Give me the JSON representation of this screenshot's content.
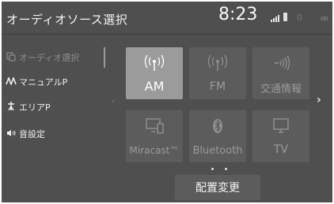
{
  "header": {
    "title": "オーディオソース選択",
    "clock": "8:23"
  },
  "sidebar": {
    "items": [
      {
        "label": "オーディオ選択",
        "icon": "audio-source-icon",
        "state": "selected"
      },
      {
        "label": "マニュアルP",
        "icon": "manual-preset-icon"
      },
      {
        "label": "エリアP",
        "icon": "area-preset-icon"
      },
      {
        "label": "音設定",
        "icon": "speaker-icon"
      }
    ]
  },
  "sources": [
    {
      "label": "AM",
      "icon": "radio-antenna-icon",
      "state": "active"
    },
    {
      "label": "FM",
      "icon": "radio-antenna-icon"
    },
    {
      "label": "交通情報",
      "icon": "traffic-info-icon"
    },
    {
      "label": "Miracast™",
      "icon": "miracast-icon"
    },
    {
      "label": "Bluetooth",
      "icon": "bluetooth-icon"
    },
    {
      "label": "TV",
      "icon": "tv-icon"
    }
  ],
  "pagination": {
    "pages": 2,
    "current": 1
  },
  "footer": {
    "layout_button": "配置変更"
  },
  "colors": {
    "background": "#4f4f4f",
    "tile": "#5c5c5c",
    "tile_active": "#9b9b9b",
    "text": "#f2f2f2",
    "text_dim": "#9a9a9a"
  }
}
